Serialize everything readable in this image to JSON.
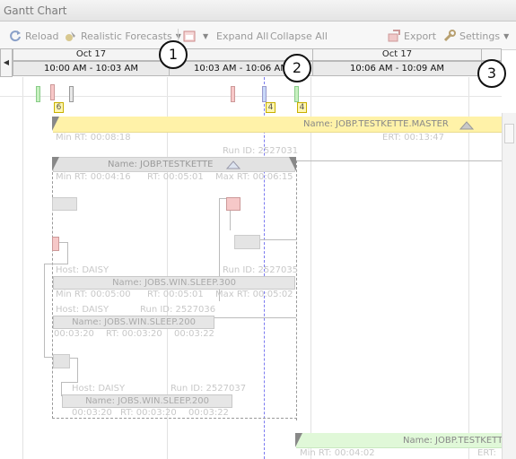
{
  "window": {
    "title": "Gantt Chart"
  },
  "toolbar": {
    "reload": "Reload",
    "forecast": "Realistic Forecasts",
    "expand": "Expand All",
    "collapse": "Collapse All",
    "export": "Export",
    "settings": "Settings"
  },
  "header": {
    "dates": [
      "Oct 17",
      "Oct 17"
    ],
    "times": [
      "10:00 AM - 10:03 AM",
      "10:03 AM - 10:06 AM",
      "10:06 AM - 10:09 AM"
    ]
  },
  "callouts": [
    "1",
    "2",
    "3"
  ],
  "badges": [
    "6",
    "4",
    "4"
  ],
  "rows": {
    "master": {
      "name": "Name: JOBP.TESTKETTE.MASTER",
      "minrt": "Min RT: 00:08:18",
      "ert": "ERT: 00:13:47"
    },
    "testkette": {
      "runid": "Run ID: 2527031",
      "name": "Name: JOBP.TESTKETTE",
      "minrt": "Min RT: 00:04:16",
      "rt": "RT: 00:05:01",
      "maxrt": "Max RT: 00:06:15"
    },
    "sleep300": {
      "host": "Host: DAISY",
      "runid": "Run ID: 2527035",
      "name": "Name: JOBS.WIN.SLEEP.300",
      "minrt": "Min RT: 00:05:00",
      "rt": "RT: 00:05:01",
      "maxrt": "Max RT: 00:05:02"
    },
    "sleep200a": {
      "host": "Host: DAISY",
      "runid": "Run ID: 2527036",
      "name": "Name: JOBS.WIN.SLEEP.200",
      "t1": "00:03:20",
      "t2": "RT: 00:03:20",
      "t3": "00:03:22"
    },
    "sleep200b": {
      "host": "Host: DAISY",
      "runid": "Run ID: 2527037",
      "name": "Name: JOBS.WIN.SLEEP.200",
      "t1": "00:03:20",
      "t2": "RT: 00:03:20",
      "t3": "00:03:22"
    },
    "bottom": {
      "name": "Name: JOBP.TESTKETTE",
      "minrt": "Min RT: 00:04:02",
      "ert": "ERT:"
    }
  }
}
